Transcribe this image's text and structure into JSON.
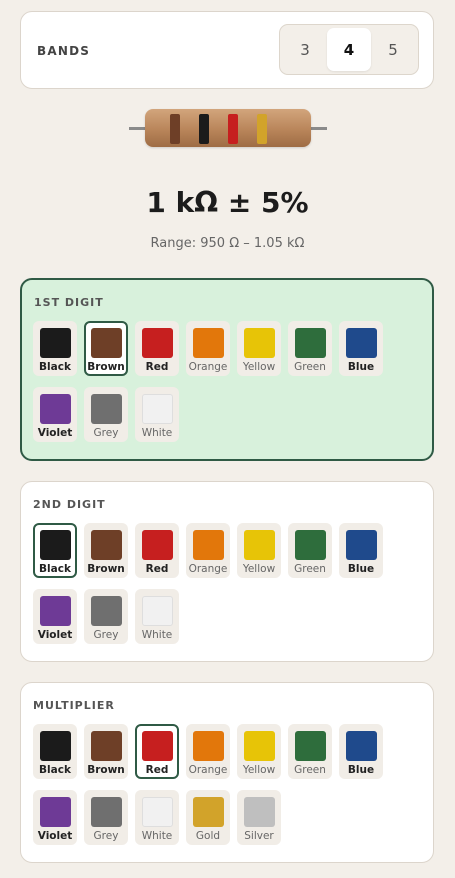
{
  "bands": {
    "label": "BANDS",
    "options": [
      "3",
      "4",
      "5"
    ],
    "selected": "4"
  },
  "resistor": {
    "band_colors": [
      "#6e3f27",
      "#1b1b1b",
      "#c61f1f",
      "#d2a32a"
    ]
  },
  "result": {
    "value": "1 kΩ ± 5%",
    "range": "Range: 950 Ω – 1.05 kΩ"
  },
  "sections": [
    {
      "title": "1ST DIGIT",
      "selected": "Brown",
      "highlighted": true,
      "chips": [
        {
          "label": "Black",
          "color": "#1b1b1b"
        },
        {
          "label": "Brown",
          "color": "#6e3f27"
        },
        {
          "label": "Red",
          "color": "#c61f1f"
        },
        {
          "label": "Orange",
          "color": "#e2770b"
        },
        {
          "label": "Yellow",
          "color": "#e7c407"
        },
        {
          "label": "Green",
          "color": "#2e6d3c"
        },
        {
          "label": "Blue",
          "color": "#1f4a8c"
        },
        {
          "label": "Violet",
          "color": "#6e3a96"
        },
        {
          "label": "Grey",
          "color": "#6f6f6f"
        },
        {
          "label": "White",
          "color": "#f1f1f1"
        }
      ]
    },
    {
      "title": "2ND DIGIT",
      "selected": "Black",
      "highlighted": false,
      "chips": [
        {
          "label": "Black",
          "color": "#1b1b1b"
        },
        {
          "label": "Brown",
          "color": "#6e3f27"
        },
        {
          "label": "Red",
          "color": "#c61f1f"
        },
        {
          "label": "Orange",
          "color": "#e2770b"
        },
        {
          "label": "Yellow",
          "color": "#e7c407"
        },
        {
          "label": "Green",
          "color": "#2e6d3c"
        },
        {
          "label": "Blue",
          "color": "#1f4a8c"
        },
        {
          "label": "Violet",
          "color": "#6e3a96"
        },
        {
          "label": "Grey",
          "color": "#6f6f6f"
        },
        {
          "label": "White",
          "color": "#f1f1f1"
        }
      ]
    },
    {
      "title": "MULTIPLIER",
      "selected": "Red",
      "highlighted": false,
      "chips": [
        {
          "label": "Black",
          "color": "#1b1b1b"
        },
        {
          "label": "Brown",
          "color": "#6e3f27"
        },
        {
          "label": "Red",
          "color": "#c61f1f"
        },
        {
          "label": "Orange",
          "color": "#e2770b"
        },
        {
          "label": "Yellow",
          "color": "#e7c407"
        },
        {
          "label": "Green",
          "color": "#2e6d3c"
        },
        {
          "label": "Blue",
          "color": "#1f4a8c"
        },
        {
          "label": "Violet",
          "color": "#6e3a96"
        },
        {
          "label": "Grey",
          "color": "#6f6f6f"
        },
        {
          "label": "White",
          "color": "#f1f1f1"
        },
        {
          "label": "Gold",
          "color": "#d2a32a"
        },
        {
          "label": "Silver",
          "color": "#bfbfbf"
        }
      ]
    }
  ]
}
